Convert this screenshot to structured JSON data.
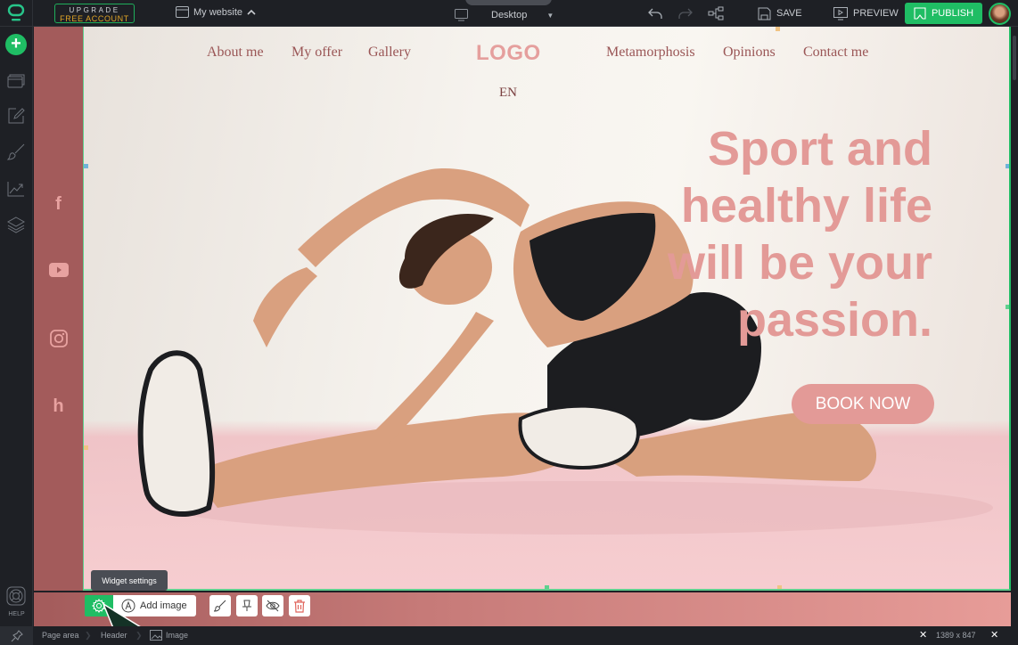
{
  "topbar": {
    "upgrade_line1": "UPGRADE",
    "upgrade_line2": "FREE ACCOUNT",
    "site_name": "My website",
    "device": "Desktop",
    "save_label": "SAVE",
    "preview_label": "PREVIEW",
    "publish_label": "PUBLISH"
  },
  "leftbar": {
    "help_label": "HELP"
  },
  "site": {
    "nav_left": [
      "About me",
      "My offer",
      "Gallery"
    ],
    "logo": "LOGO",
    "nav_right": [
      "Metamorphosis",
      "Opinions",
      "Contact me"
    ],
    "language": "EN",
    "headline_lines": [
      "Sport and",
      "healthy life",
      "will be your",
      "passion."
    ],
    "cta": "BOOK NOW",
    "social": [
      "facebook",
      "youtube",
      "instagram",
      "houzz"
    ],
    "colors": {
      "accent": "#e39a97",
      "sidebar": "#a35b5b",
      "nav_text": "#9a5656"
    }
  },
  "widget_toolbar": {
    "tooltip": "Widget settings",
    "add_image_label": "Add image"
  },
  "statusbar": {
    "crumbs": [
      "Page area",
      "Header",
      "Image"
    ],
    "dimensions": "1389 x 847"
  },
  "colors": {
    "brand_green": "#1fbd64",
    "topbar_bg": "#1e2025"
  }
}
